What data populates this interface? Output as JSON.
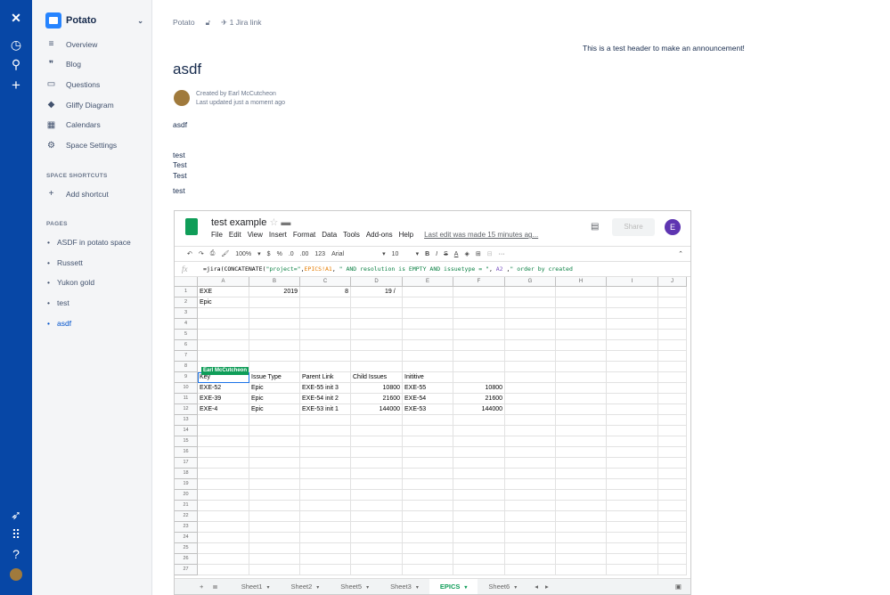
{
  "global_nav": {
    "icons": [
      "confluence-logo-icon",
      "recent-icon",
      "search-icon",
      "create-icon",
      "notifications-icon",
      "app-switcher-icon",
      "help-icon",
      "profile-avatar"
    ]
  },
  "sidebar": {
    "space_name": "Potato",
    "items": [
      {
        "label": "Overview",
        "icon": "≡"
      },
      {
        "label": "Blog",
        "icon": "❞"
      },
      {
        "label": "Questions",
        "icon": "▭"
      },
      {
        "label": "Gliffy Diagram",
        "icon": "◆"
      },
      {
        "label": "Calendars",
        "icon": "▦"
      },
      {
        "label": "Space Settings",
        "icon": "⚙"
      }
    ],
    "shortcuts_heading": "SPACE SHORTCUTS",
    "add_shortcut": "Add shortcut",
    "pages_heading": "PAGES",
    "pages": [
      "ASDF in potato space",
      "Russett",
      "Yukon gold",
      "test",
      "asdf"
    ]
  },
  "page": {
    "breadcrumb": "Potato",
    "jira_link": "1 Jira link",
    "announcement": "This is a test header to make an announcement!",
    "title": "asdf",
    "created_by": "Created by Earl McCutcheon",
    "updated": "Last updated just a moment ago",
    "body": [
      "asdf",
      "test",
      "Test",
      "Test",
      "test"
    ]
  },
  "sheet": {
    "title": "test example",
    "menu": [
      "File",
      "Edit",
      "View",
      "Insert",
      "Format",
      "Data",
      "Tools",
      "Add-ons",
      "Help"
    ],
    "last_edit": "Last edit was made 15 minutes ag...",
    "share": "Share",
    "user_initial": "E",
    "toolbar": {
      "zoom": "100%",
      "currency": "$",
      "percent": "%",
      "dec_less": ".0",
      "dec_more": ".00",
      "format": "123",
      "font": "Arial",
      "size": "10"
    },
    "formula": {
      "p1": "=jira(CONCATENATE(",
      "s1": "\"project=\"",
      "p2": ",",
      "r1": "EPICS!A1",
      "p3": ", ",
      "s2": "\" AND resolution is EMPTY AND issuetype = \"",
      "p4": ", ",
      "r2": "A2",
      "p5": " ,",
      "s3": "\" order by created"
    },
    "columns": [
      "A",
      "B",
      "C",
      "D",
      "E",
      "F",
      "G",
      "H",
      "I",
      "J"
    ],
    "rows": [
      [
        "EXE",
        "2019",
        "8",
        "19 /",
        "",
        "",
        "",
        "",
        "",
        ""
      ],
      [
        "Epic",
        "",
        "",
        "",
        "",
        "",
        "",
        "",
        "",
        ""
      ],
      [],
      [],
      [],
      [],
      [],
      [],
      [
        "Key",
        "Issue Type",
        "Parent Link",
        "Child Issues",
        "Inititive",
        "",
        "",
        "",
        "",
        ""
      ],
      [
        "EXE-52",
        "Epic",
        "EXE-55 init 3",
        "10800",
        "EXE-55",
        "10800",
        "",
        "",
        "",
        ""
      ],
      [
        "EXE-39",
        "Epic",
        "EXE-54 init 2",
        "21600",
        "EXE-54",
        "21600",
        "",
        "",
        "",
        ""
      ],
      [
        "EXE-4",
        "Epic",
        "EXE-53 init 1",
        "144000",
        "EXE-53",
        "144000",
        "",
        "",
        "",
        ""
      ]
    ],
    "row_count": 27,
    "collab_tag": "Earl McCutcheon",
    "tabs": [
      "Sheet1",
      "Sheet2",
      "Sheet5",
      "Sheet3",
      "EPICS",
      "Sheet6"
    ],
    "active_tab": "EPICS",
    "accent": "#0f9d58"
  }
}
